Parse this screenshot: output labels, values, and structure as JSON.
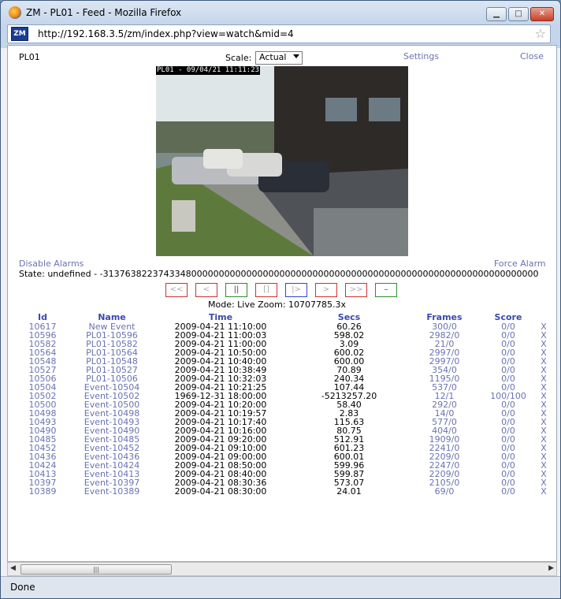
{
  "window": {
    "title": "ZM - PL01 - Feed - Mozilla Firefox",
    "url": "http://192.168.3.5/zm/index.php?view=watch&mid=4",
    "zm_icon_text": "ZM"
  },
  "header": {
    "monitor": "PL01",
    "scale_label": "Scale:",
    "scale_value": "Actual",
    "settings": "Settings",
    "close": "Close"
  },
  "feed": {
    "timestamp": "PL01 - 09/04/21 11:11:23"
  },
  "alarms": {
    "disable": "Disable Alarms",
    "force": "Force Alarm"
  },
  "state_text": "State: undefined - -3137638223743348000000000000000000000000000000000000000000000000000000000000000",
  "controls": [
    "<<",
    "<",
    "||",
    "[]",
    "|>",
    ">",
    ">>",
    "–"
  ],
  "mode_text": "Mode: Live   Zoom: 10707785.3x",
  "table": {
    "headers": [
      "Id",
      "Name",
      "Time",
      "Secs",
      "Frames",
      "Score"
    ],
    "rows": [
      [
        "10617",
        "New Event",
        "2009-04-21 11:10:00",
        "60.26",
        "300/0",
        "0/0",
        "X"
      ],
      [
        "10596",
        "PL01-10596",
        "2009-04-21 11:00:03",
        "598.02",
        "2982/0",
        "0/0",
        "X"
      ],
      [
        "10582",
        "PL01-10582",
        "2009-04-21 11:00:00",
        "3.09",
        "21/0",
        "0/0",
        "X"
      ],
      [
        "10564",
        "PL01-10564",
        "2009-04-21 10:50:00",
        "600.02",
        "2997/0",
        "0/0",
        "X"
      ],
      [
        "10548",
        "PL01-10548",
        "2009-04-21 10:40:00",
        "600.00",
        "2997/0",
        "0/0",
        "X"
      ],
      [
        "10527",
        "PL01-10527",
        "2009-04-21 10:38:49",
        "70.89",
        "354/0",
        "0/0",
        "X"
      ],
      [
        "10506",
        "PL01-10506",
        "2009-04-21 10:32:03",
        "240.34",
        "1195/0",
        "0/0",
        "X"
      ],
      [
        "10504",
        "Event-10504",
        "2009-04-21 10:21:25",
        "107.44",
        "537/0",
        "0/0",
        "X"
      ],
      [
        "10502",
        "Event-10502",
        "1969-12-31 18:00:00",
        "-5213257.20",
        "12/1",
        "100/100",
        "X"
      ],
      [
        "10500",
        "Event-10500",
        "2009-04-21 10:20:00",
        "58.40",
        "292/0",
        "0/0",
        "X"
      ],
      [
        "10498",
        "Event-10498",
        "2009-04-21 10:19:57",
        "2.83",
        "14/0",
        "0/0",
        "X"
      ],
      [
        "10493",
        "Event-10493",
        "2009-04-21 10:17:40",
        "115.63",
        "577/0",
        "0/0",
        "X"
      ],
      [
        "10490",
        "Event-10490",
        "2009-04-21 10:16:00",
        "80.75",
        "404/0",
        "0/0",
        "X"
      ],
      [
        "10485",
        "Event-10485",
        "2009-04-21 09:20:00",
        "512.91",
        "1909/0",
        "0/0",
        "X"
      ],
      [
        "10452",
        "Event-10452",
        "2009-04-21 09:10:00",
        "601.23",
        "2241/0",
        "0/0",
        "X"
      ],
      [
        "10436",
        "Event-10436",
        "2009-04-21 09:00:00",
        "600.01",
        "2209/0",
        "0/0",
        "X"
      ],
      [
        "10424",
        "Event-10424",
        "2009-04-21 08:50:00",
        "599.96",
        "2247/0",
        "0/0",
        "X"
      ],
      [
        "10413",
        "Event-10413",
        "2009-04-21 08:40:00",
        "599.87",
        "2209/0",
        "0/0",
        "X"
      ],
      [
        "10397",
        "Event-10397",
        "2009-04-21 08:30:36",
        "573.07",
        "2105/0",
        "0/0",
        "X"
      ],
      [
        "10389",
        "Event-10389",
        "2009-04-21 08:30:00",
        "24.01",
        "69/0",
        "0/0",
        "X"
      ]
    ]
  },
  "status": "Done"
}
